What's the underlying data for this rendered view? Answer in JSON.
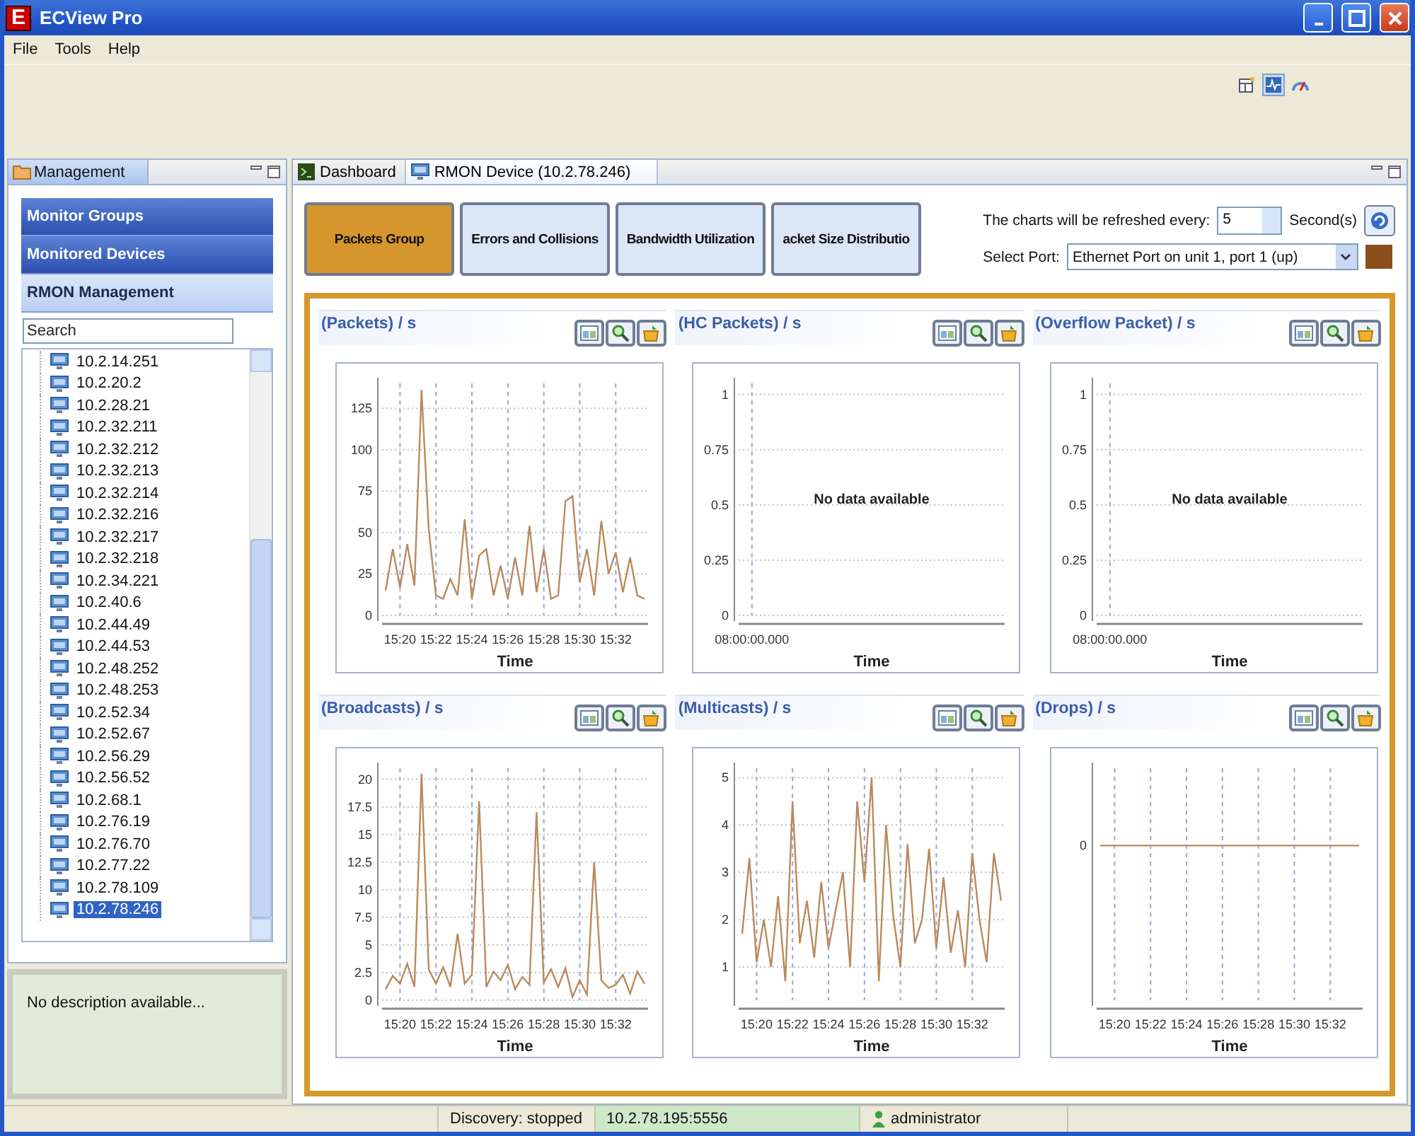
{
  "window": {
    "logo": "E",
    "title": "ECView Pro"
  },
  "menu": [
    "File",
    "Tools",
    "Help"
  ],
  "perspectives": [
    {
      "kind": "table",
      "selected": false
    },
    {
      "kind": "chart",
      "selected": true
    },
    {
      "kind": "gauge",
      "selected": false
    }
  ],
  "left_panel": {
    "title": "Management",
    "sections": [
      {
        "label": "Monitor Groups",
        "selected": false
      },
      {
        "label": "Monitored Devices",
        "selected": false
      },
      {
        "label": "RMON Management",
        "selected": true
      }
    ],
    "search": {
      "placeholder": "Search"
    },
    "devices": [
      {
        "label": "10.2.14.251",
        "selected": false
      },
      {
        "label": "10.2.20.2",
        "selected": false
      },
      {
        "label": "10.2.28.21",
        "selected": false
      },
      {
        "label": "10.2.32.211",
        "selected": false
      },
      {
        "label": "10.2.32.212",
        "selected": false
      },
      {
        "label": "10.2.32.213",
        "selected": false
      },
      {
        "label": "10.2.32.214",
        "selected": false
      },
      {
        "label": "10.2.32.216",
        "selected": false
      },
      {
        "label": "10.2.32.217",
        "selected": false
      },
      {
        "label": "10.2.32.218",
        "selected": false
      },
      {
        "label": "10.2.34.221",
        "selected": false
      },
      {
        "label": "10.2.40.6",
        "selected": false
      },
      {
        "label": "10.2.44.49",
        "selected": false
      },
      {
        "label": "10.2.44.53",
        "selected": false
      },
      {
        "label": "10.2.48.252",
        "selected": false
      },
      {
        "label": "10.2.48.253",
        "selected": false
      },
      {
        "label": "10.2.52.34",
        "selected": false
      },
      {
        "label": "10.2.52.67",
        "selected": false
      },
      {
        "label": "10.2.56.29",
        "selected": false
      },
      {
        "label": "10.2.56.52",
        "selected": false
      },
      {
        "label": "10.2.68.1",
        "selected": false
      },
      {
        "label": "10.2.76.19",
        "selected": false
      },
      {
        "label": "10.2.76.70",
        "selected": false
      },
      {
        "label": "10.2.77.22",
        "selected": false
      },
      {
        "label": "10.2.78.109",
        "selected": false
      },
      {
        "label": "10.2.78.246",
        "selected": true
      }
    ],
    "description": "No description available..."
  },
  "editor": {
    "tabs": [
      {
        "label": "Dashboard",
        "kind": "console",
        "selected": false
      },
      {
        "label": "RMON Device (10.2.78.246)",
        "kind": "monitor",
        "selected": true
      }
    ],
    "groups": [
      {
        "label": "Packets Group",
        "selected": true
      },
      {
        "label": "Errors and Collisions",
        "selected": false
      },
      {
        "label": "Bandwidth Utilization",
        "selected": false
      },
      {
        "label": "acket Size Distributio",
        "selected": false
      }
    ],
    "refresh": {
      "label": "The charts will be refreshed every:",
      "value": "5",
      "unit": "Second(s)"
    },
    "port": {
      "label": "Select Port:",
      "value": "Ethernet Port on unit 1, port 1 (up)",
      "color": "#8b4f1e"
    },
    "charts": [
      {
        "title": "(Packets) / s",
        "chart_data": {
          "type": "line",
          "xlabel": "Time",
          "grid": true,
          "categories": [
            null,
            null,
            "15:20",
            null,
            null,
            null,
            null,
            "15:22",
            null,
            null,
            null,
            null,
            "15:24",
            null,
            null,
            null,
            null,
            "15:26",
            null,
            null,
            null,
            null,
            "15:28",
            null,
            null,
            null,
            null,
            "15:30",
            null,
            null,
            null,
            null,
            "15:32",
            null,
            null,
            null,
            null
          ],
          "series": [
            {
              "color": "#b98a5e",
              "values": [
                15,
                40,
                17,
                43,
                18,
                136,
                52,
                12,
                10,
                22,
                12,
                58,
                10,
                36,
                40,
                12,
                30,
                10,
                35,
                12,
                54,
                14,
                40,
                10,
                12,
                69,
                72,
                20,
                40,
                12,
                57,
                25,
                38,
                14,
                35,
                12,
                10
              ]
            }
          ],
          "ylim": [
            0,
            140
          ],
          "yticks": [
            0,
            25,
            50,
            75,
            100,
            125
          ]
        }
      },
      {
        "title": "(HC Packets) / s",
        "chart_data": {
          "type": "line",
          "xlabel": "Time",
          "grid": true,
          "categories": [
            "08:00:00.000",
            null,
            null,
            null,
            null,
            null,
            null,
            null,
            null,
            null
          ],
          "series": [
            {
              "values": [
                null,
                null,
                null,
                null,
                null,
                null,
                null,
                null,
                null,
                null
              ]
            }
          ],
          "ylim": [
            0,
            1.05
          ],
          "yticks": [
            0,
            0.25,
            0.5,
            0.75,
            1
          ],
          "annotations": [
            {
              "text": "No data available"
            }
          ]
        }
      },
      {
        "title": "(Overflow Packet) / s",
        "chart_data": {
          "type": "line",
          "xlabel": "Time",
          "grid": true,
          "categories": [
            "08:00:00.000",
            null,
            null,
            null,
            null,
            null,
            null,
            null,
            null,
            null
          ],
          "series": [
            {
              "values": [
                null,
                null,
                null,
                null,
                null,
                null,
                null,
                null,
                null,
                null
              ]
            }
          ],
          "ylim": [
            0,
            1.05
          ],
          "yticks": [
            0,
            0.25,
            0.5,
            0.75,
            1
          ],
          "annotations": [
            {
              "text": "No data available"
            }
          ]
        }
      },
      {
        "title": "(Broadcasts) / s",
        "chart_data": {
          "type": "line",
          "xlabel": "Time",
          "grid": true,
          "categories": [
            null,
            null,
            "15:20",
            null,
            null,
            null,
            null,
            "15:22",
            null,
            null,
            null,
            null,
            "15:24",
            null,
            null,
            null,
            null,
            "15:26",
            null,
            null,
            null,
            null,
            "15:28",
            null,
            null,
            null,
            null,
            "15:30",
            null,
            null,
            null,
            null,
            "15:32",
            null,
            null,
            null,
            null
          ],
          "series": [
            {
              "color": "#b98a5e",
              "values": [
                1,
                2.2,
                1.5,
                3.3,
                1.2,
                20.5,
                2.8,
                1.5,
                3,
                1.2,
                6,
                1.5,
                2.3,
                18,
                1.2,
                2.6,
                1.8,
                3.2,
                1,
                2.1,
                1.4,
                17,
                1.6,
                2.8,
                1.2,
                2.9,
                0.3,
                1.8,
                0.5,
                12.5,
                1.8,
                1.1,
                1.4,
                2.3,
                0.6,
                2.6,
                1.5
              ]
            }
          ],
          "ylim": [
            0,
            21
          ],
          "yticks": [
            0,
            2.5,
            5,
            7.5,
            10,
            12.5,
            15,
            17.5,
            20
          ]
        }
      },
      {
        "title": "(Multicasts) / s",
        "chart_data": {
          "type": "line",
          "xlabel": "Time",
          "grid": true,
          "categories": [
            null,
            null,
            "15:20",
            null,
            null,
            null,
            null,
            "15:22",
            null,
            null,
            null,
            null,
            "15:24",
            null,
            null,
            null,
            null,
            "15:26",
            null,
            null,
            null,
            null,
            "15:28",
            null,
            null,
            null,
            null,
            "15:30",
            null,
            null,
            null,
            null,
            "15:32",
            null,
            null,
            null,
            null
          ],
          "series": [
            {
              "color": "#b98a5e",
              "values": [
                1.7,
                3.3,
                1.1,
                2,
                1,
                2.5,
                0.7,
                4.5,
                1.5,
                2.4,
                1.2,
                2.8,
                1.4,
                2.2,
                3,
                1,
                4.5,
                2.8,
                5,
                0.7,
                4,
                2.1,
                1,
                3.6,
                1.5,
                2,
                3.5,
                1.4,
                2.9,
                1.3,
                2.2,
                1,
                3.4,
                2,
                1.1,
                3.4,
                2.4
              ]
            }
          ],
          "ylim": [
            0.3,
            5.2
          ],
          "yticks": [
            1,
            2,
            3,
            4,
            5
          ]
        }
      },
      {
        "title": "(Drops) / s",
        "plot": {
          "y_label": "0",
          "x_labels": [
            "15:20",
            "15:22",
            "15:24",
            "15:26",
            "15:28",
            "15:30",
            "15:32"
          ],
          "xlabel": "Time"
        }
      }
    ]
  },
  "status_bar": {
    "discovery": "Discovery: stopped",
    "server": "10.2.78.195:5556",
    "user": "administrator"
  }
}
